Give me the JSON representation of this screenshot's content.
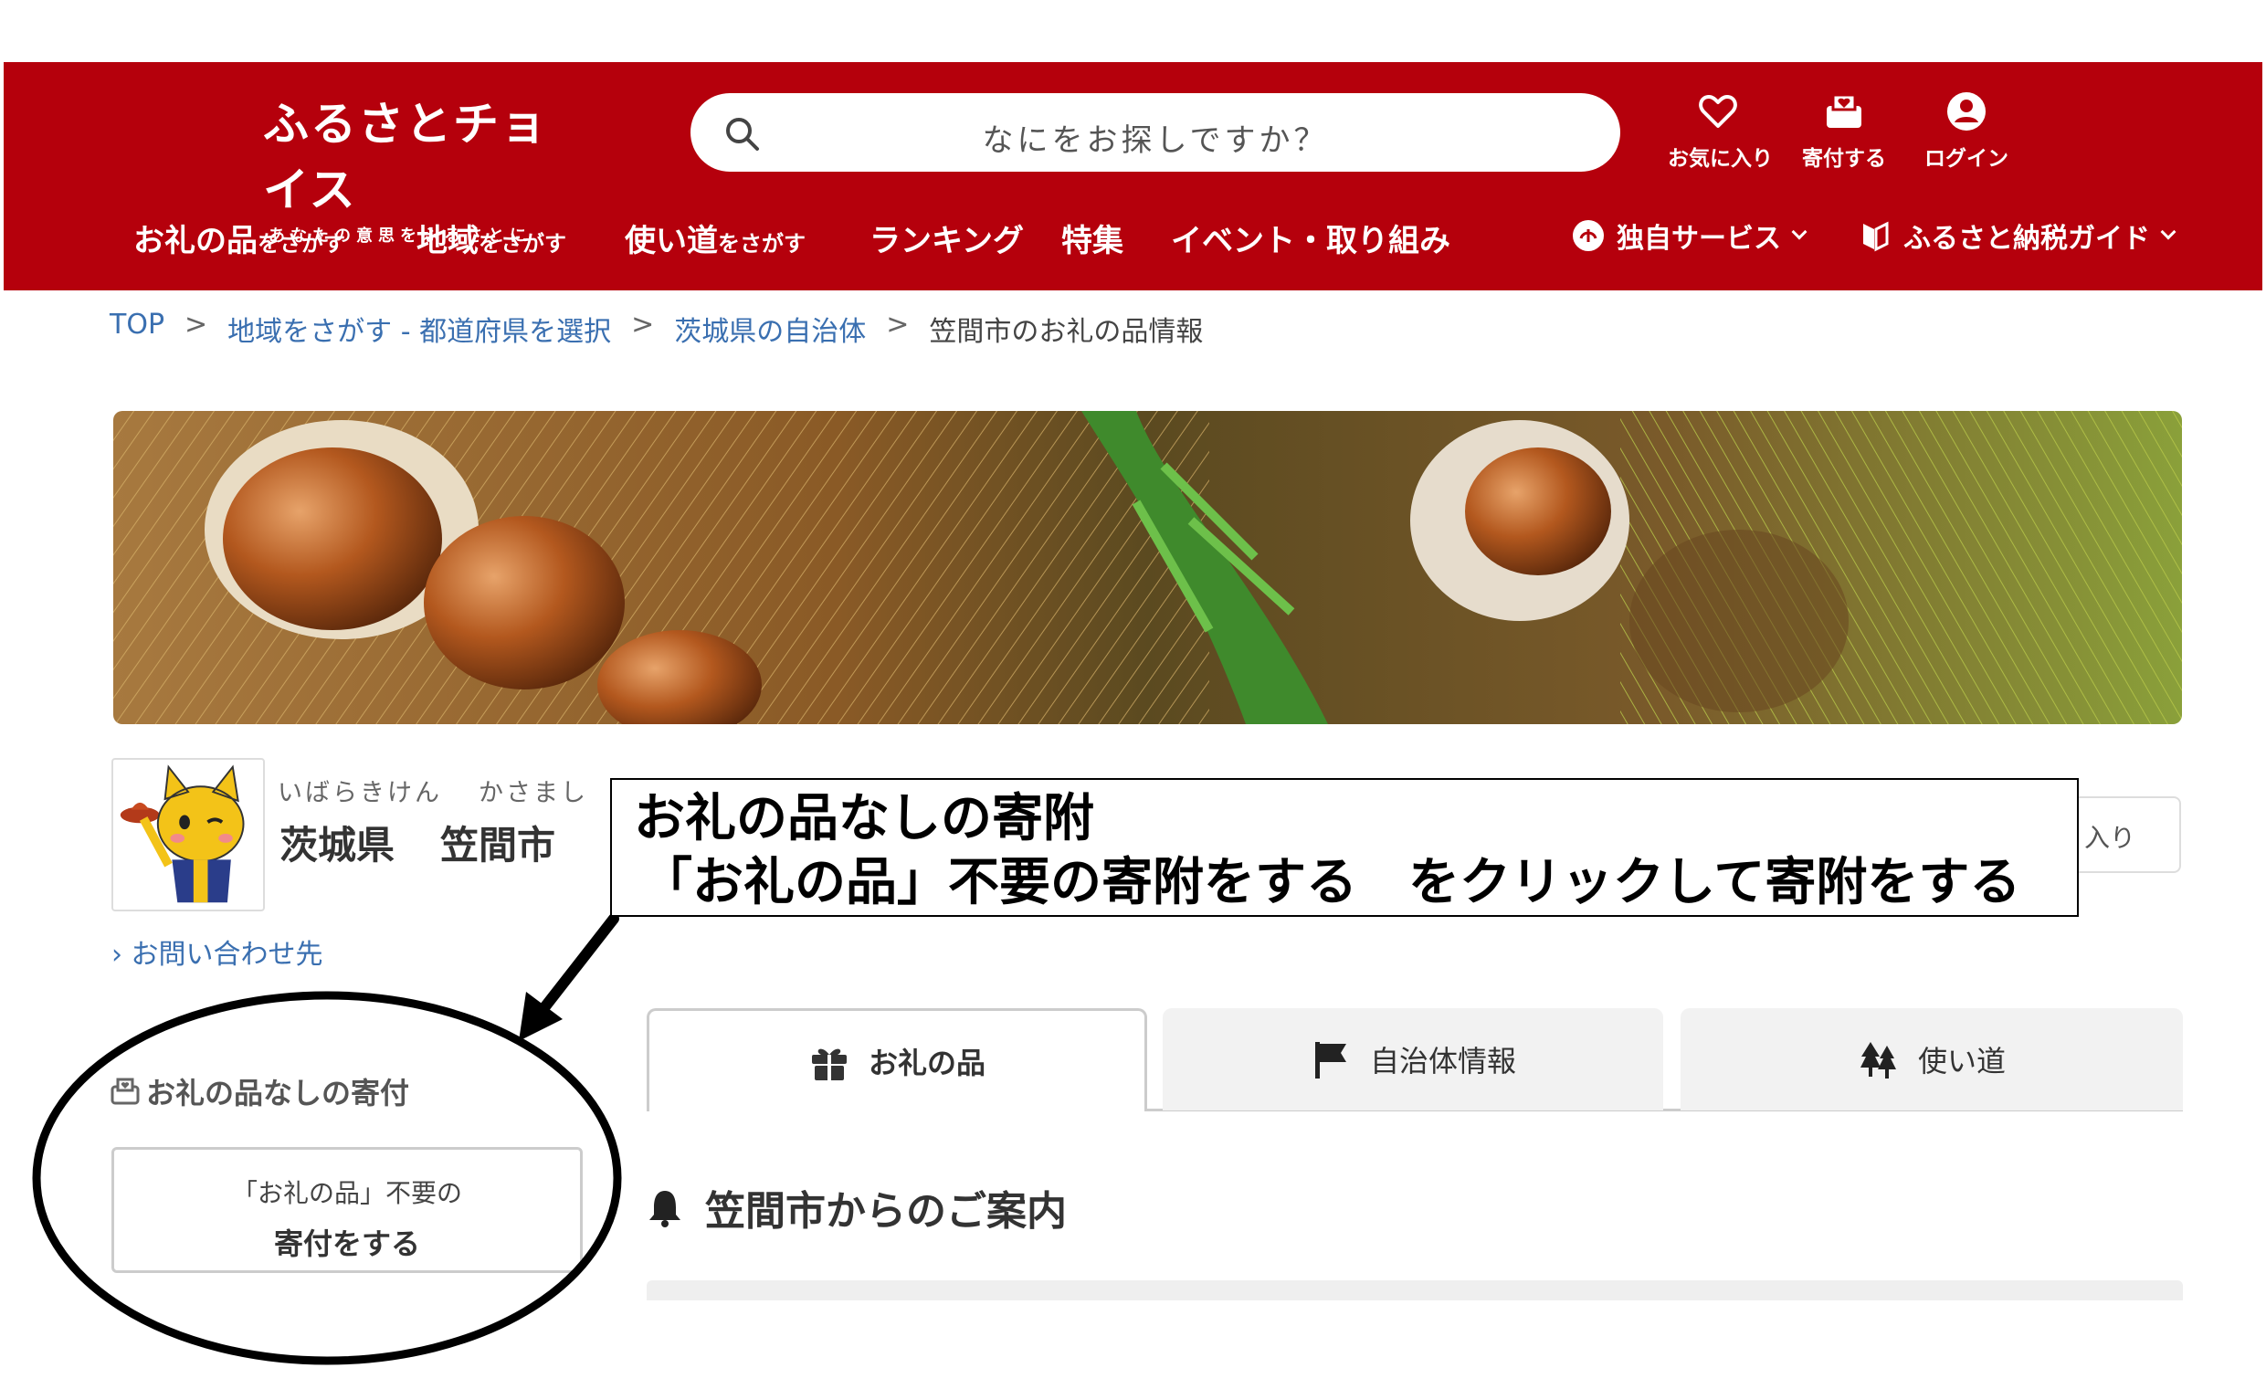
{
  "header": {
    "logo_main": "ふるさとチョイス",
    "logo_tagline": "あなたの意思をふるさとに",
    "search_placeholder": "なにをお探しですか？",
    "icons": [
      {
        "label": "お気に入り",
        "icon": "heart-icon"
      },
      {
        "label": "寄付する",
        "icon": "donate-icon"
      },
      {
        "label": "ログイン",
        "icon": "user-icon"
      }
    ],
    "colors": {
      "brand": "#b5000c",
      "link": "#3a6fb0"
    }
  },
  "nav": {
    "gifts": {
      "main": "お礼の品",
      "sub": "をさがす"
    },
    "region": {
      "main": "地域",
      "sub": "をさがす"
    },
    "usage": {
      "main": "使い道",
      "sub": "をさがす"
    },
    "ranking": "ランキング",
    "features": "特集",
    "events": "イベント・取り組み",
    "services": "独自サービス",
    "guide": "ふるさと納税ガイド"
  },
  "breadcrumb": {
    "items": [
      "TOP",
      "地域をさがす - 都道府県を選択",
      "茨城県の自治体",
      "笠間市のお礼の品情報"
    ],
    "separator": ">"
  },
  "city": {
    "pref_ruby": "いばらきけん",
    "city_ruby": "かさまし",
    "pref": "茨城県",
    "city": "笠間市",
    "contact": "お問い合わせ先",
    "favorite_partial": "入り"
  },
  "sidebar": {
    "nogift_heading": "お礼の品なしの寄付",
    "nogift_button_line1": "「お礼の品」不要の",
    "nogift_button_line2": "寄付をする"
  },
  "tabs": [
    {
      "label": "お礼の品",
      "icon": "gift-icon",
      "active": true
    },
    {
      "label": "自治体情報",
      "icon": "flag-icon",
      "active": false
    },
    {
      "label": "使い道",
      "icon": "tree-icon",
      "active": false
    }
  ],
  "notice": {
    "title": "笠間市からのご案内"
  },
  "annotation": {
    "title": "お礼の品なしの寄附",
    "body": "「お礼の品」不要の寄附をする　をクリックして寄附をする"
  }
}
